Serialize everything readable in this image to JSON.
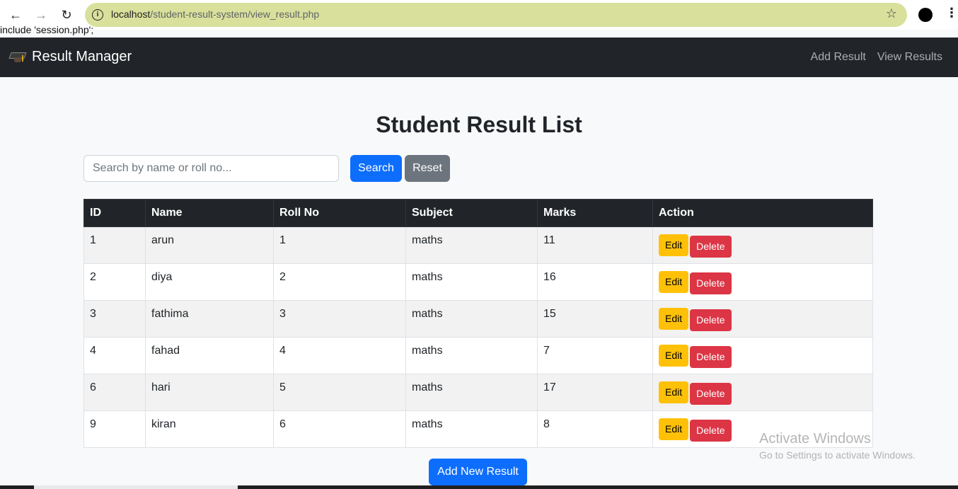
{
  "browser": {
    "url_host": "localhost",
    "url_path": "/student-result-system/view_result.php",
    "leaked_text": "include 'session.php';"
  },
  "navbar": {
    "brand": "Result Manager",
    "links": [
      "Add Result",
      "View Results"
    ]
  },
  "page": {
    "title": "Student Result List",
    "search_placeholder": "Search by name or roll no...",
    "search_label": "Search",
    "reset_label": "Reset",
    "add_new_label": "Add New Result"
  },
  "table": {
    "headers": [
      "ID",
      "Name",
      "Roll No",
      "Subject",
      "Marks",
      "Action"
    ],
    "rows": [
      {
        "id": "1",
        "name": "arun",
        "roll": "1",
        "subject": "maths",
        "marks": "11"
      },
      {
        "id": "2",
        "name": "diya",
        "roll": "2",
        "subject": "maths",
        "marks": "16"
      },
      {
        "id": "3",
        "name": "fathima",
        "roll": "3",
        "subject": "maths",
        "marks": "15"
      },
      {
        "id": "4",
        "name": "fahad",
        "roll": "4",
        "subject": "maths",
        "marks": "7"
      },
      {
        "id": "6",
        "name": "hari",
        "roll": "5",
        "subject": "maths",
        "marks": "17"
      },
      {
        "id": "9",
        "name": "kiran",
        "roll": "6",
        "subject": "maths",
        "marks": "8"
      }
    ],
    "edit_label": "Edit",
    "delete_label": "Delete"
  },
  "watermark": {
    "title": "Activate Windows",
    "subtitle": "Go to Settings to activate Windows."
  },
  "colors": {
    "primary": "#0d6efd",
    "secondary": "#6c757d",
    "warning": "#ffc107",
    "danger": "#dc3545",
    "dark": "#212529"
  }
}
